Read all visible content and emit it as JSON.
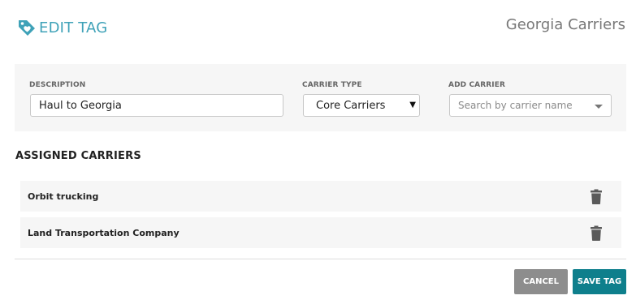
{
  "header": {
    "title": "EDIT TAG",
    "tag_name": "Georgia Carriers",
    "icon": "tag-heart-icon",
    "accent_color": "#3fa2b8"
  },
  "form": {
    "description": {
      "label": "DESCRIPTION",
      "value": "Haul to Georgia"
    },
    "carrier_type": {
      "label": "CARRIER TYPE",
      "selected": "Core Carriers"
    },
    "add_carrier": {
      "label": "ADD CARRIER",
      "placeholder": "Search by carrier name"
    }
  },
  "assigned": {
    "title": "ASSIGNED CARRIERS",
    "carriers": [
      {
        "name": "Orbit trucking"
      },
      {
        "name": "Land Transportation Company"
      }
    ]
  },
  "actions": {
    "cancel_label": "CANCEL",
    "save_label": "SAVE TAG",
    "cancel_color": "#8d8d8d",
    "save_color": "#0e7f8c"
  }
}
